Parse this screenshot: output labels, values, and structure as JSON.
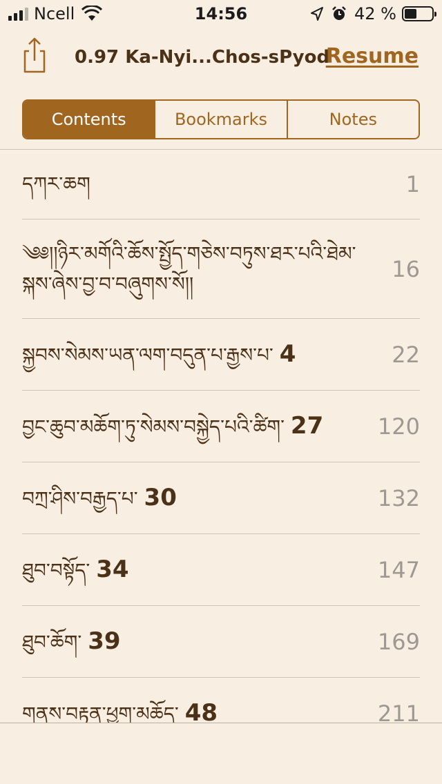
{
  "status_bar": {
    "carrier": "Ncell",
    "time": "14:56",
    "battery_percent": "42 %",
    "battery_level": 0.42,
    "icons": [
      "signal-icon",
      "wifi-icon",
      "location-arrow-icon",
      "alarm-icon",
      "battery-icon"
    ]
  },
  "navbar": {
    "share_icon": "share-icon",
    "title": "0.97 Ka-Nyi...Chos-sPyod",
    "resume_label": "Resume"
  },
  "tabs": [
    {
      "label": "Contents",
      "selected": true
    },
    {
      "label": "Bookmarks",
      "selected": false
    },
    {
      "label": "Notes",
      "selected": false
    }
  ],
  "contents": [
    {
      "title": "དཀར་ཆག",
      "number": "",
      "page": "1"
    },
    {
      "title": "༄༅།།ཉིར་མགོའི་ཆོས་སྤྱོད་གཅེས་བཏུས་ཐར་པའི་ཐེམ་སྐས་ཞེས་བྱ་བ་བཞུགས་སོ།།",
      "number": "",
      "page": "16"
    },
    {
      "title": "སྐྱབས་སེམས་ཡན་ལག་བདུན་པ་རྒྱས་པ་",
      "number": "4",
      "page": "22"
    },
    {
      "title": "བྱང་ཆུབ་མཆོག་ཏུ་སེམས་བསྐྱེད་པའི་ཚིག་",
      "number": "27",
      "page": "120"
    },
    {
      "title": "བཀྲ་ཤིས་བརྒྱད་པ་",
      "number": "30",
      "page": "132"
    },
    {
      "title": "ཐུབ་བསྟོད་",
      "number": "34",
      "page": "147"
    },
    {
      "title": "ཐུབ་ཆོག་",
      "number": "39",
      "page": "169"
    },
    {
      "title": "གནས་བརྟན་ཕྱག་མཆོད་",
      "number": "48",
      "page": "211"
    }
  ],
  "colors": {
    "background": "#f8efe2",
    "accent": "#a0651f",
    "text": "#4a3118",
    "page_number": "#9e9892",
    "divider": "#cdc3b5"
  }
}
